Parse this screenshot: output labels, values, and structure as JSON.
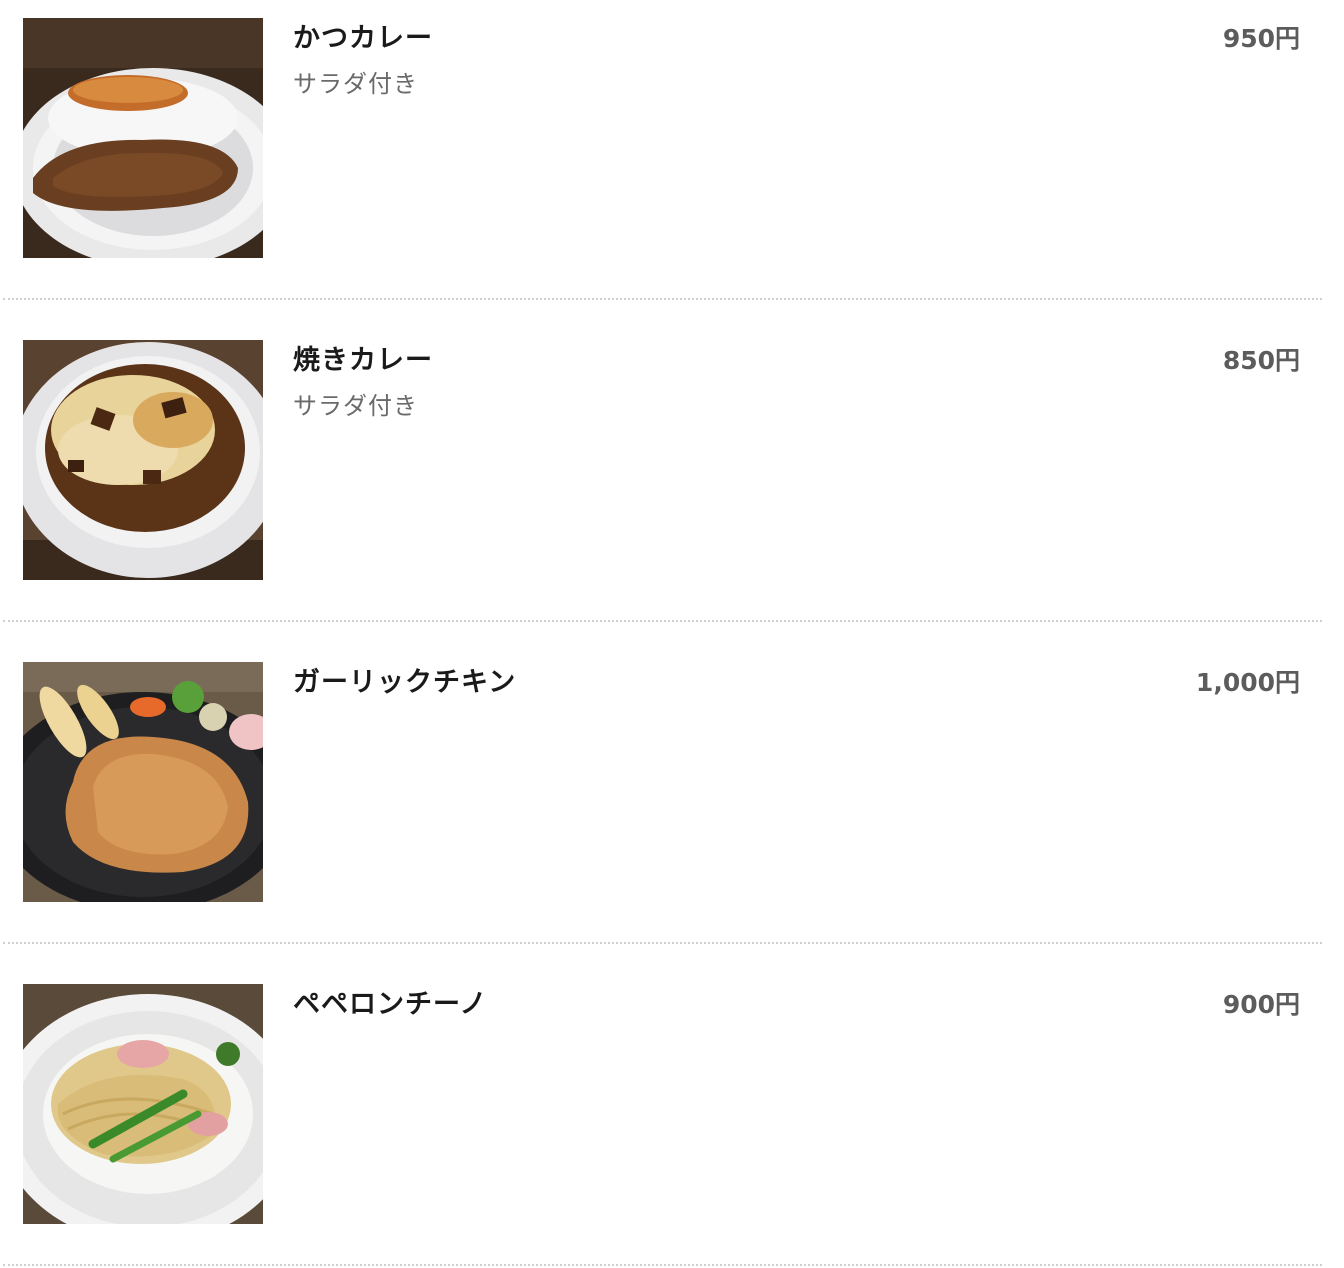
{
  "menu": {
    "items": [
      {
        "name": "かつカレー",
        "description": "サラダ付き",
        "price": "950円",
        "image": "katsu-curry-photo"
      },
      {
        "name": "焼きカレー",
        "description": "サラダ付き",
        "price": "850円",
        "image": "baked-curry-photo"
      },
      {
        "name": "ガーリックチキン",
        "description": "",
        "price": "1,000円",
        "image": "garlic-chicken-photo"
      },
      {
        "name": "ペペロンチーノ",
        "description": "",
        "price": "900円",
        "image": "peperoncino-photo"
      }
    ]
  }
}
